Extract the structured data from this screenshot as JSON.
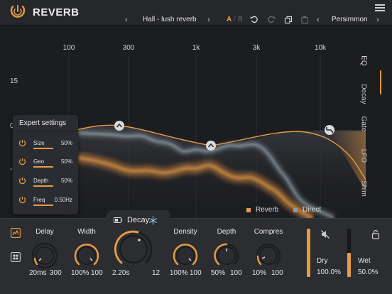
{
  "app": {
    "title": "REVERB",
    "accent": "#e39b44",
    "direct_color": "#8a9ba6"
  },
  "toolbar": {
    "prev_preset": "‹",
    "preset_name": "Hall - lush reverb",
    "next_preset": "›",
    "ab_a": "A",
    "ab_sep": "/",
    "ab_b": "B",
    "undo_icon": "undo-icon",
    "redo_icon": "redo-icon",
    "copy_icon": "copy-icon",
    "paste_icon": "paste-icon",
    "prev_theme": "‹",
    "theme_name": "Persimmon",
    "next_theme": "›"
  },
  "display": {
    "freq_labels": [
      "100",
      "300",
      "1k",
      "3k",
      "10k"
    ],
    "db_labels": [
      "15",
      "0",
      "-"
    ],
    "side_tabs": [
      "EQ",
      "Decay",
      "Gate",
      "LFO",
      "Shim"
    ],
    "active_tab": "EQ",
    "legend": {
      "reverb": "Reverb",
      "direct": "Direct"
    }
  },
  "expert": {
    "title": "Expert settings",
    "rows": [
      {
        "name": "Size",
        "value": "50%",
        "level": 0.5
      },
      {
        "name": "Geo",
        "value": "50%",
        "level": 0.5
      },
      {
        "name": "Depth",
        "value": "50%",
        "level": 0.5
      },
      {
        "name": "Freq",
        "value": "0.50Hz",
        "level": 0.5
      }
    ]
  },
  "controls": {
    "decay_tab_label": "Decay",
    "snowflake_icon": "freeze-icon",
    "delay": {
      "label": "Delay",
      "value": "20ms",
      "max": "300"
    },
    "width": {
      "label": "Width",
      "value": "100%",
      "max": "100"
    },
    "decay": {
      "label": "",
      "value": "2.20s",
      "max": "12"
    },
    "density": {
      "label": "Density",
      "value": "100%",
      "max": "100"
    },
    "depth": {
      "label": "Depth",
      "value": "50%",
      "max": "100"
    },
    "compres": {
      "label": "Compres",
      "value": "10%",
      "max": "100"
    },
    "dry": {
      "label": "Dry",
      "value": "100.0%",
      "level": 1.0
    },
    "wet": {
      "label": "Wet",
      "value": "50.0%",
      "level": 0.5
    },
    "mute_icon": "mute-icon",
    "lock_icon": "lock-icon"
  }
}
